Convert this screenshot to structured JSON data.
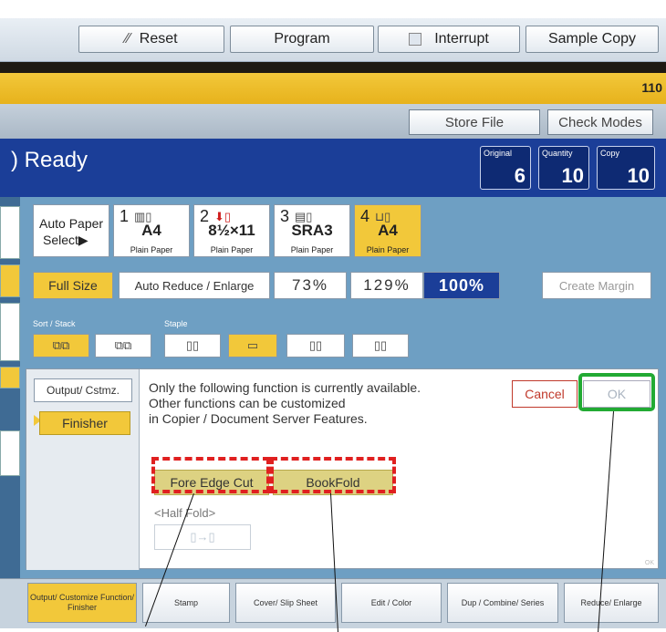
{
  "toolbar": {
    "reset_label": "Reset",
    "program_label": "Program",
    "interrupt_label": "Interrupt",
    "sample_copy_label": "Sample Copy"
  },
  "counter_fragment": "110",
  "store_file_label": "Store File",
  "check_modes_label": "Check Modes",
  "status": {
    "ready": "Ready",
    "original_label": "Original",
    "original_value": "6",
    "quantity_label": "Quantity",
    "quantity_value": "10",
    "copy_label": "Copy",
    "copy_value": "10"
  },
  "paper": {
    "auto_paper_line1": "Auto Paper",
    "auto_paper_line2": "Select▶",
    "trays": [
      {
        "number": "1",
        "size": "A4",
        "type": "Plain Paper"
      },
      {
        "number": "2",
        "size": "8½×11",
        "type": "Plain Paper"
      },
      {
        "number": "3",
        "size": "SRA3",
        "type": "Plain Paper"
      },
      {
        "number": "4",
        "size": "A4",
        "type": "Plain Paper"
      }
    ]
  },
  "ratio": {
    "full_size": "Full Size",
    "auto_reduce": "Auto Reduce / Enlarge",
    "r73": "73%",
    "r129": "129%",
    "r100": "100%",
    "create_margin": "Create Margin"
  },
  "sort_stack_label": "Sort / Stack",
  "staple_label": "Staple",
  "dialog": {
    "tab_label": "Output/ Cstmz.",
    "finisher_label": "Finisher",
    "message_line1": "Only the following function is currently available.",
    "message_line2": "Other functions can be customized",
    "message_line3": "in Copier / Document Server Features.",
    "cancel_label": "Cancel",
    "ok_label": "OK",
    "fore_edge_cut": "Fore Edge Cut",
    "bookfold": "BookFold",
    "half_fold": "<Half Fold>",
    "ok_small": "OK"
  },
  "bottom_tabs": [
    "Output/ Customize Function/ Finisher",
    "Stamp",
    "Cover/ Slip Sheet",
    "Edit / Color",
    "Dup / Combine/ Series",
    "Reduce/ Enlarge"
  ],
  "colors": {
    "status_blue": "#1b3e98",
    "panel_blue": "#6e9fc3",
    "accent_yellow": "#f2c83a",
    "highlight_red": "#e02020",
    "highlight_green": "#22aa33"
  }
}
